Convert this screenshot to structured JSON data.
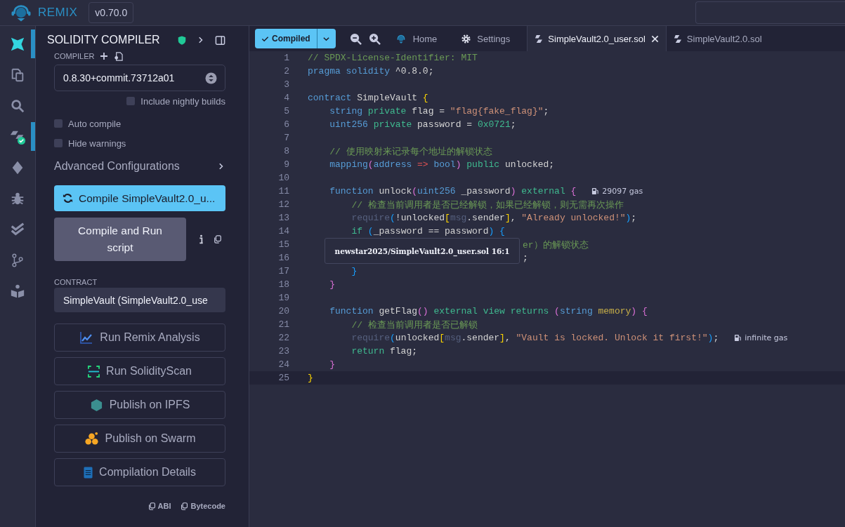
{
  "app": {
    "name": "REMIX",
    "version": "v0.70.0"
  },
  "icon_rail": [
    {
      "kind": "ai",
      "selected": true
    },
    {
      "kind": "files",
      "selected": false
    },
    {
      "kind": "search",
      "selected": false
    },
    {
      "kind": "compiler",
      "selected": true
    },
    {
      "kind": "deploy",
      "selected": false
    },
    {
      "kind": "debug",
      "selected": false
    },
    {
      "kind": "tests",
      "selected": false
    },
    {
      "kind": "git",
      "selected": false
    },
    {
      "kind": "learn",
      "selected": false
    }
  ],
  "panel": {
    "title": "SOLIDITY COMPILER",
    "compiler_label": "COMPILER",
    "compiler_version": "0.8.30+commit.73712a01",
    "options": [
      {
        "kind": "nightly",
        "label": "Include nightly builds",
        "checked": false
      },
      {
        "kind": "toggle",
        "label": "Auto compile",
        "checked": false
      },
      {
        "kind": "toggle",
        "label": "Hide warnings",
        "checked": false
      }
    ],
    "advanced": "Advanced Configurations",
    "compile_button": "Compile SimpleVault2.0_u...",
    "run_script_button": "Compile and Run script",
    "contract_label": "CONTRACT",
    "contract": "SimpleVault (SimpleVault2.0_use",
    "actions": [
      {
        "kind": "analysis",
        "label": "Run Remix Analysis"
      },
      {
        "kind": "scan",
        "label": "Run SolidityScan"
      },
      {
        "kind": "ipfs",
        "label": "Publish on IPFS"
      },
      {
        "kind": "swarm",
        "label": "Publish on Swarm"
      },
      {
        "kind": "details",
        "label": "Compilation Details"
      }
    ],
    "copy_links": [
      "ABI",
      "Bytecode"
    ]
  },
  "editor": {
    "compile_status": "Compiled",
    "tabs": [
      {
        "kind": "home",
        "label": "Home",
        "selected": false,
        "closable": false
      },
      {
        "kind": "settings",
        "label": "Settings",
        "selected": false,
        "closable": false
      },
      {
        "kind": "file",
        "label": "SimpleVault2.0_user.sol",
        "selected": true,
        "closable": true
      },
      {
        "kind": "file",
        "label": "SimpleVault2.0.sol",
        "selected": false,
        "closable": false
      }
    ],
    "lines": [
      {
        "n": "1",
        "tokens": [
          {
            "kind": "cm",
            "text": "// SPDX-License-Identifier: MIT"
          }
        ]
      },
      {
        "n": "2",
        "tokens": [
          {
            "kind": "kw",
            "text": "pragma solidity"
          },
          {
            "kind": "pl",
            "text": " ^0.8.0;"
          }
        ]
      },
      {
        "n": "3"
      },
      {
        "n": "4",
        "tokens": [
          {
            "kind": "kw",
            "text": "contract"
          },
          {
            "kind": "pl",
            "text": " SimpleVault "
          },
          {
            "kind": "b1",
            "text": "{"
          }
        ]
      },
      {
        "n": "5",
        "tokens": [
          {
            "kind": "kw",
            "text": "    string"
          },
          {
            "kind": "md",
            "text": " private"
          },
          {
            "kind": "pl",
            "text": " flag = "
          },
          {
            "kind": "st",
            "text": "\"flag{fake_flag}\""
          },
          {
            "kind": "pl",
            "text": ";"
          }
        ]
      },
      {
        "n": "6",
        "tokens": [
          {
            "kind": "kw",
            "text": "    uint256"
          },
          {
            "kind": "md",
            "text": " private"
          },
          {
            "kind": "pl",
            "text": " password = "
          },
          {
            "kind": "nm",
            "text": "0x0721"
          },
          {
            "kind": "pl",
            "text": ";"
          }
        ]
      },
      {
        "n": "7"
      },
      {
        "n": "8",
        "tokens": [
          {
            "kind": "cm",
            "text": "    // 使用映射来记录每个地址的解锁状态"
          }
        ]
      },
      {
        "n": "9",
        "tokens": [
          {
            "kind": "kw",
            "text": "    mapping"
          },
          {
            "kind": "b2",
            "text": "("
          },
          {
            "kind": "kw",
            "text": "address"
          },
          {
            "kind": "op",
            "text": " =>"
          },
          {
            "kind": "kw",
            "text": " bool"
          },
          {
            "kind": "b2",
            "text": ")"
          },
          {
            "kind": "md",
            "text": " public"
          },
          {
            "kind": "pl",
            "text": " unlocked;"
          }
        ]
      },
      {
        "n": "10"
      },
      {
        "n": "11",
        "tokens": [
          {
            "kind": "kw",
            "text": "    function"
          },
          {
            "kind": "pl",
            "text": " unlock"
          },
          {
            "kind": "b2",
            "text": "("
          },
          {
            "kind": "kw",
            "text": "uint256"
          },
          {
            "kind": "pl",
            "text": " _password"
          },
          {
            "kind": "b2",
            "text": ")"
          },
          {
            "kind": "md",
            "text": " external"
          },
          {
            "kind": "b2",
            "text": " {"
          }
        ],
        "gas": "29097 gas"
      },
      {
        "n": "12",
        "tokens": [
          {
            "kind": "cm",
            "text": "        // 检查当前调用者是否已经解锁，如果已经解锁，则无需再次操作"
          }
        ]
      },
      {
        "n": "13",
        "tokens": [
          {
            "kind": "dm",
            "text": "        require"
          },
          {
            "kind": "b3",
            "text": "("
          },
          {
            "kind": "pl",
            "text": "!unlocked"
          },
          {
            "kind": "b1",
            "text": "["
          },
          {
            "kind": "dm",
            "text": "msg"
          },
          {
            "kind": "pl",
            "text": ".sender"
          },
          {
            "kind": "b1",
            "text": "]"
          },
          {
            "kind": "pl",
            "text": ","
          },
          {
            "kind": "st",
            "text": " \"Already unlocked!\""
          },
          {
            "kind": "b3",
            "text": ")"
          },
          {
            "kind": "pl",
            "text": ";"
          }
        ]
      },
      {
        "n": "14",
        "tokens": [
          {
            "kind": "md",
            "text": "        if"
          },
          {
            "kind": "b3",
            "text": " ("
          },
          {
            "kind": "pl",
            "text": "_password == password"
          },
          {
            "kind": "b3",
            "text": ") {"
          }
        ]
      },
      {
        "n": "15",
        "covered": true,
        "tokens": [
          {
            "kind": "cm",
            "text": "er）的解锁状态"
          }
        ]
      },
      {
        "n": "16",
        "covered": true,
        "tokens": [
          {
            "kind": "pl",
            "text": ";"
          }
        ]
      },
      {
        "n": "17",
        "tokens": [
          {
            "kind": "b3",
            "text": "        }"
          }
        ]
      },
      {
        "n": "18",
        "tokens": [
          {
            "kind": "b2",
            "text": "    }"
          }
        ]
      },
      {
        "n": "19"
      },
      {
        "n": "20",
        "tokens": [
          {
            "kind": "kw",
            "text": "    function"
          },
          {
            "kind": "pl",
            "text": " getFlag"
          },
          {
            "kind": "b2",
            "text": "()"
          },
          {
            "kind": "md",
            "text": " external view returns"
          },
          {
            "kind": "b2",
            "text": " ("
          },
          {
            "kind": "kw",
            "text": "string"
          },
          {
            "kind": "me",
            "text": " memory"
          },
          {
            "kind": "b2",
            "text": ") {"
          }
        ]
      },
      {
        "n": "21",
        "tokens": [
          {
            "kind": "cm",
            "text": "        // 检查当前调用者是否已解锁"
          }
        ]
      },
      {
        "n": "22",
        "tokens": [
          {
            "kind": "dm",
            "text": "        require"
          },
          {
            "kind": "b3",
            "text": "("
          },
          {
            "kind": "pl",
            "text": "unlocked"
          },
          {
            "kind": "b1",
            "text": "["
          },
          {
            "kind": "dm",
            "text": "msg"
          },
          {
            "kind": "pl",
            "text": ".sender"
          },
          {
            "kind": "b1",
            "text": "]"
          },
          {
            "kind": "pl",
            "text": ","
          },
          {
            "kind": "st",
            "text": " \"Vault is locked. Unlock it first!\""
          },
          {
            "kind": "b3",
            "text": ")"
          },
          {
            "kind": "pl",
            "text": ";"
          }
        ],
        "gas": "infinite gas"
      },
      {
        "n": "23",
        "tokens": [
          {
            "kind": "md",
            "text": "        return"
          },
          {
            "kind": "pl",
            "text": " flag;"
          }
        ]
      },
      {
        "n": "24",
        "tokens": [
          {
            "kind": "b2",
            "text": "    }"
          }
        ]
      },
      {
        "n": "25",
        "current": true,
        "tokens": [
          {
            "kind": "b1",
            "text": "}"
          }
        ]
      }
    ],
    "tooltip": "newstar2025/SimpleVault2.0_user.sol 16:1"
  }
}
